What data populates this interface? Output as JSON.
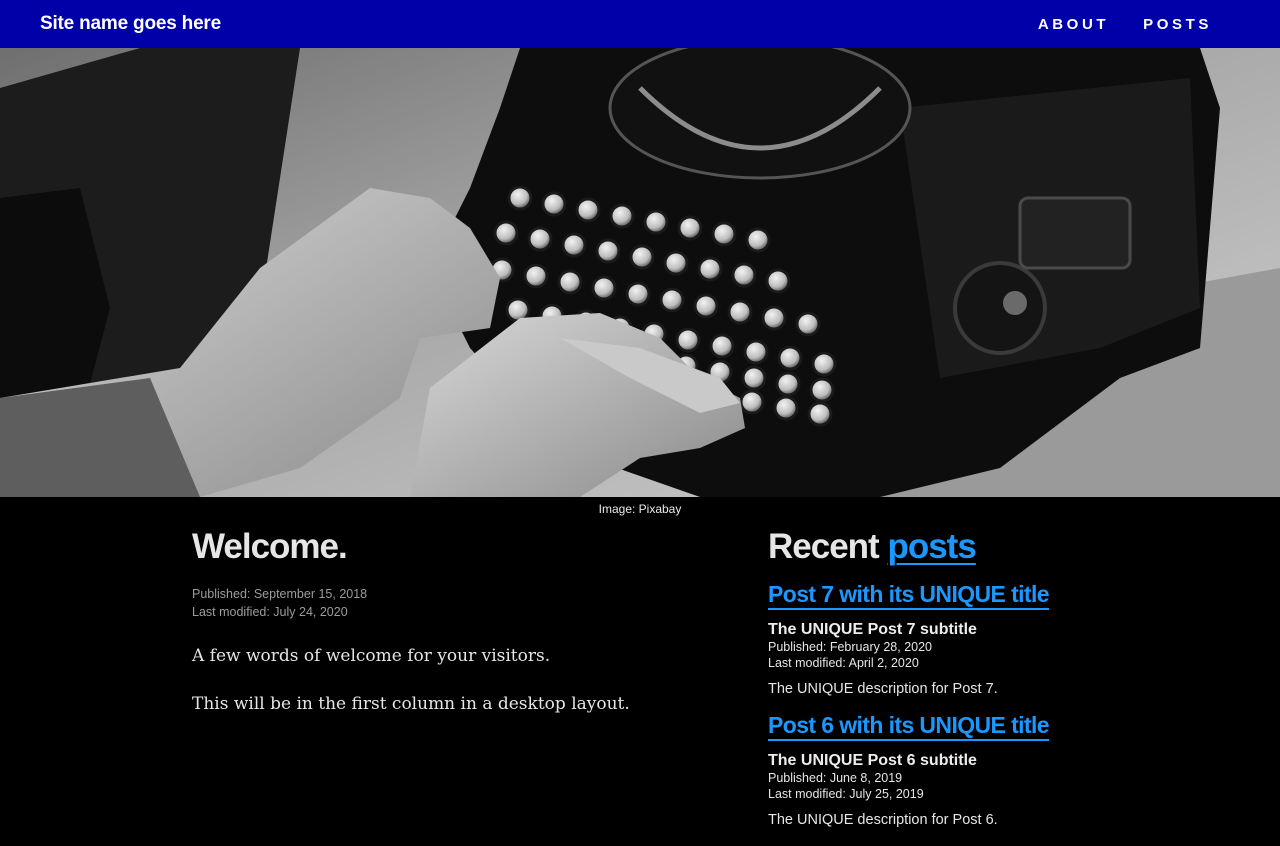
{
  "header": {
    "site_name": "Site name goes here",
    "nav": [
      {
        "label": "ABOUT"
      },
      {
        "label": "POSTS"
      }
    ]
  },
  "hero": {
    "caption": "Image: Pixabay"
  },
  "welcome": {
    "title": "Welcome.",
    "published": "Published: September 15, 2018",
    "modified": "Last modified: July 24, 2020",
    "paragraphs": [
      "A few words of welcome for your visitors.",
      "This will be in the first column in a desktop layout."
    ]
  },
  "recent": {
    "heading_prefix": "Recent",
    "heading_link": "posts",
    "posts": [
      {
        "title": "Post 7 with its UNIQUE title",
        "subtitle": "The UNIQUE Post 7 subtitle",
        "published": "Published: February 28, 2020",
        "modified": "Last modified: April 2, 2020",
        "description": "The UNIQUE description for Post 7."
      },
      {
        "title": "Post 6 with its UNIQUE title",
        "subtitle": "The UNIQUE Post 6 subtitle",
        "published": "Published: June 8, 2019",
        "modified": "Last modified: July 25, 2019",
        "description": "The UNIQUE description for Post 6."
      }
    ]
  },
  "colors": {
    "header_bg": "#0000a8",
    "link": "#1a98ff",
    "page_bg": "#000000"
  }
}
